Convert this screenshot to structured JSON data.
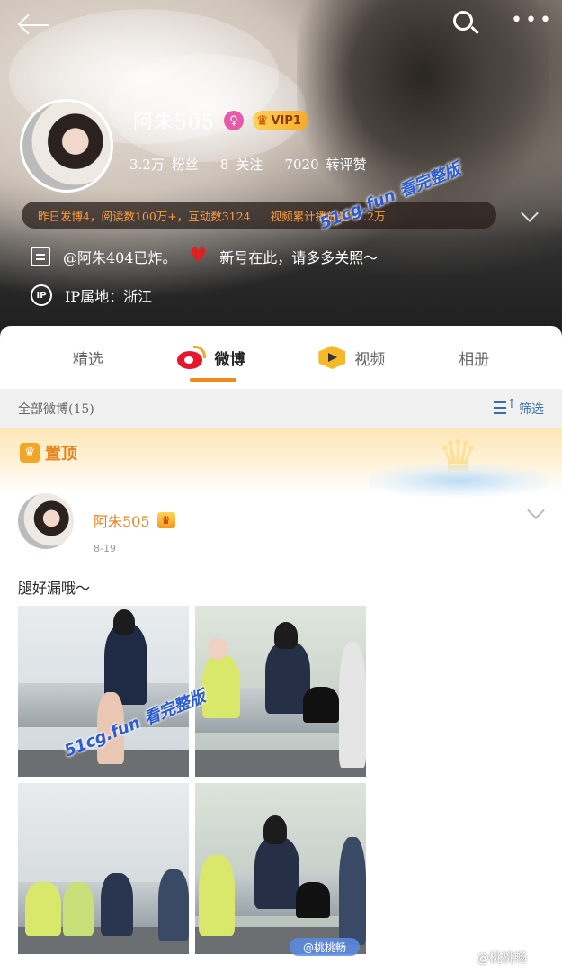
{
  "header": {
    "back_icon": "back-arrow-icon",
    "search_icon": "search-icon",
    "more_icon": "more-icon",
    "more_glyph": "•••"
  },
  "profile": {
    "name": "阿朱505",
    "verified_badge": "♀",
    "vip_label": "VIP1",
    "stats": [
      {
        "value": "3.2万",
        "label": "粉丝"
      },
      {
        "value": "8",
        "label": "关注"
      },
      {
        "value": "7020",
        "label": "转评赞"
      }
    ],
    "highlight": {
      "text": "昨日发博4，阅读数100万+，互动数3124",
      "video_text": "视频累计播放量77.2万"
    },
    "bio": {
      "prefix": "@阿朱404已炸。",
      "suffix": "新号在此，请多多关照～"
    },
    "ip": {
      "badge": "IP",
      "text": "IP属地：浙江"
    }
  },
  "tabs": [
    {
      "label": "精选",
      "active": false
    },
    {
      "label": "微博",
      "active": true
    },
    {
      "label": "视频",
      "active": false
    },
    {
      "label": "相册",
      "active": false
    }
  ],
  "filter": {
    "all_label": "全部微博(15)",
    "filter_label": "筛选"
  },
  "pinned": {
    "label": "置顶"
  },
  "post": {
    "author": "阿朱505",
    "date": "8-19",
    "text": "腿好漏哦～"
  },
  "watermarks": {
    "site": "51cg.fun 看完整版",
    "photo_tag": "@桃桃畅",
    "footer": "@桃桃畅"
  },
  "colors": {
    "accent": "#f08a18",
    "highlight_text": "#ff9b3d",
    "weibo_red": "#e6162d",
    "link_blue": "#3b6ea8"
  }
}
